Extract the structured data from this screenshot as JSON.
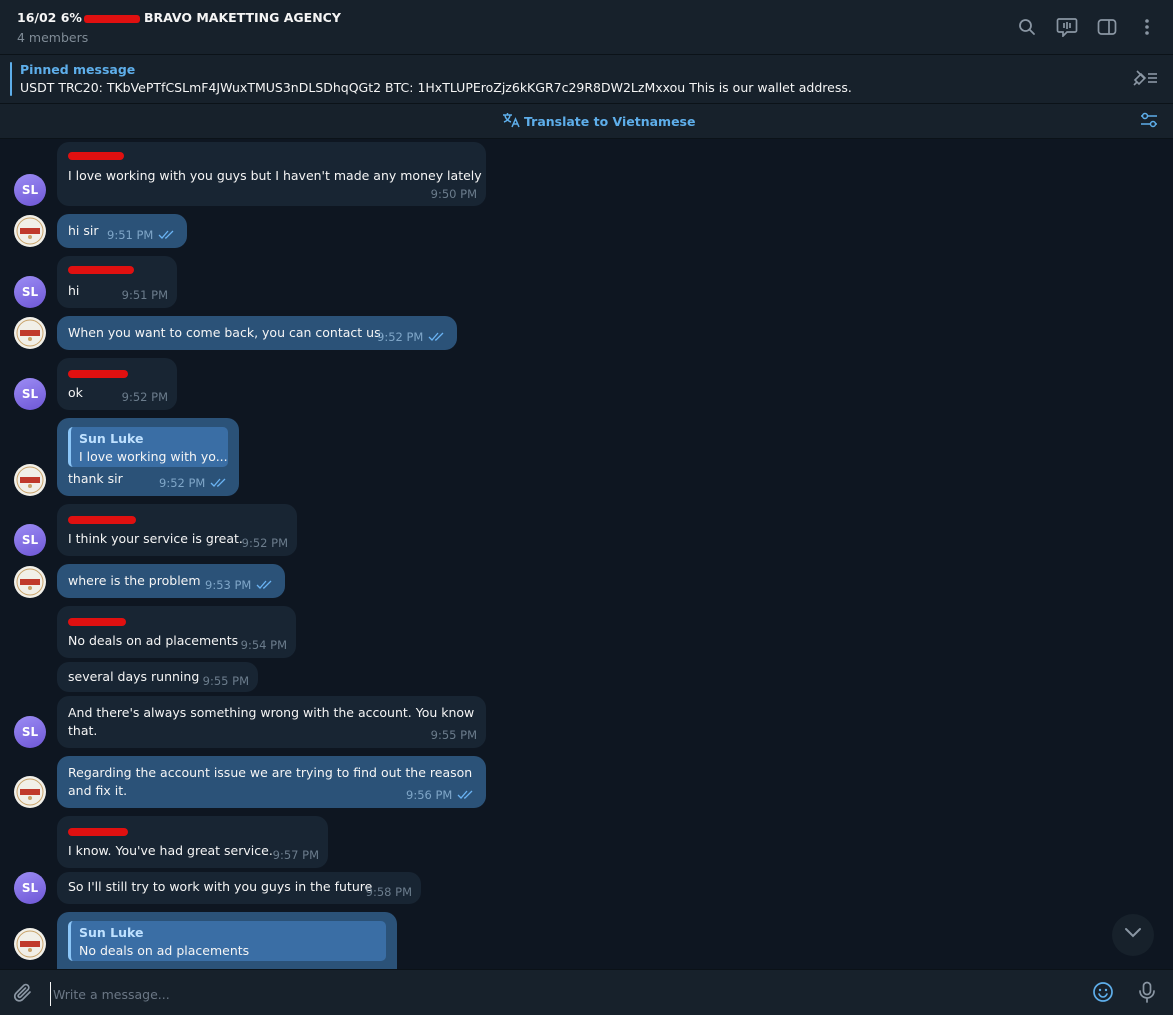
{
  "header": {
    "title_prefix": "16/02 6%",
    "title_suffix": "BRAVO MAKETTING AGENCY",
    "subtitle": "4 members",
    "icons": [
      "search-icon",
      "live-stream-icon",
      "sidebar-toggle-icon",
      "more-vert-icon"
    ]
  },
  "pinned": {
    "label": "Pinned message",
    "text": "USDT TRC20: TKbVePTfCSLmF4JWuxTMUS3nDLSDhqQGt2 BTC: 1HxTLUPEroZjz6kKGR7c29R8DW2LzMxxou This is our wallet address."
  },
  "translate": {
    "label": "Translate to Vietnamese"
  },
  "messages": [
    {
      "text": "I love working with you guys but I haven't made any money lately",
      "time": "9:50 PM"
    },
    {
      "text": "hi sir",
      "time": "9:51 PM"
    },
    {
      "text": "hi",
      "time": "9:51 PM"
    },
    {
      "text": "When you want to come back, you can contact us.",
      "time": "9:52 PM"
    },
    {
      "text": "ok",
      "time": "9:52 PM"
    },
    {
      "reply_name": "Sun Luke",
      "reply_text": "I love working with yo...",
      "text": "thank sir",
      "time": "9:52 PM"
    },
    {
      "text": "I think your service is great.",
      "time": "9:52 PM"
    },
    {
      "text": "where is the problem",
      "time": "9:53 PM"
    },
    {
      "text": "No deals on ad placements",
      "time": "9:54 PM"
    },
    {
      "text": "several days running",
      "time": "9:55 PM"
    },
    {
      "text": "And there's always something wrong with the account. You know that.",
      "time": "9:55 PM"
    },
    {
      "text": "Regarding the account issue we are trying to find out the reason and fix it.",
      "time": "9:56 PM"
    },
    {
      "text": "I know. You've had great service.",
      "time": "9:57 PM"
    },
    {
      "text": "So I'll still try to work with you guys in the future",
      "time": "9:58 PM"
    },
    {
      "reply_name": "Sun Luke",
      "reply_text": "No deals on ad placements"
    }
  ],
  "avatar_initials": "SL",
  "composer": {
    "placeholder": "Write a message..."
  },
  "colors": {
    "background": "#0e1621",
    "panel": "#17212b",
    "incoming": "#182533",
    "outgoing": "#2b5278",
    "accent": "#5eaeea"
  }
}
